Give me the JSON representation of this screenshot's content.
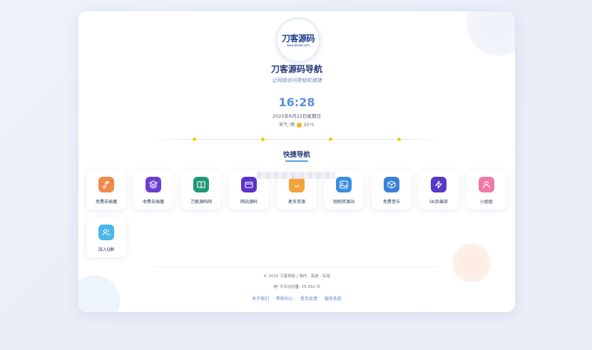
{
  "site": {
    "logo_text": "刀客源码",
    "logo_sub": "www.dkewl.com",
    "title": "刀客源码导航",
    "slogan": "让网络访问更轻松便捷"
  },
  "clock": {
    "time": "16:28",
    "date": "2025年6月22日星期日",
    "weather_label": "天气:",
    "weather_condition": "晴",
    "temperature": "25°C"
  },
  "quick_nav": {
    "title": "快捷导航",
    "items": [
      {
        "label": "免费去插播",
        "icon": "music-note-icon",
        "color": "#f28a4e"
      },
      {
        "label": "收费去插播",
        "icon": "layers-icon",
        "color": "#6a3fd0"
      },
      {
        "label": "刀客源码网",
        "icon": "book-icon",
        "color": "#1f9a74"
      },
      {
        "label": "网站源码",
        "icon": "wallet-icon",
        "color": "#5a32c9"
      },
      {
        "label": "更多资源",
        "icon": "smile-icon",
        "color": "#f4a33b"
      },
      {
        "label": "短剧资源站",
        "icon": "image-icon",
        "color": "#3b8fdc"
      },
      {
        "label": "免费音乐",
        "icon": "package-icon",
        "color": "#3c7fd8"
      },
      {
        "label": "SK反编译",
        "icon": "zap-icon",
        "color": "#5838c8"
      },
      {
        "label": "小姐姐",
        "icon": "user-icon",
        "color": "#f07aa3"
      },
      {
        "label": "加入Q群",
        "icon": "users-icon",
        "color": "#4ab7e8"
      }
    ]
  },
  "footer": {
    "copyright": "© 2025 刀客导航 | 简约 · 高效 · 实用",
    "visits": "今日访问量: 15,355 次",
    "links": [
      "关于我们",
      "帮助中心",
      "意见反馈",
      "服务条款"
    ]
  }
}
